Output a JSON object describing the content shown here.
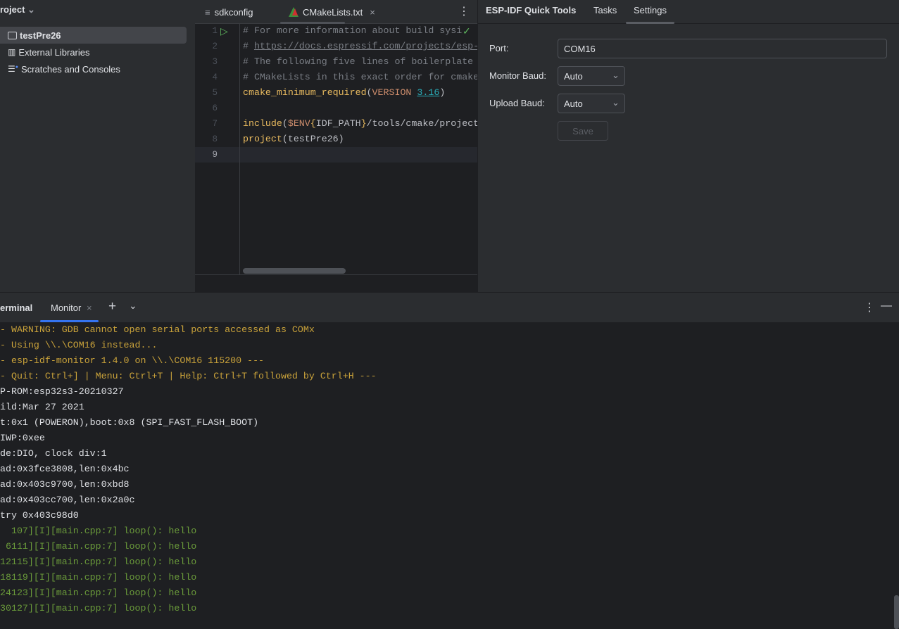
{
  "project": {
    "title": "roject",
    "items": [
      {
        "label": "testPre26",
        "icon": "folder-icon",
        "selected": true
      },
      {
        "label": "External Libraries",
        "icon": "library-icon"
      },
      {
        "label": "Scratches and Consoles",
        "icon": "scratches-icon"
      }
    ]
  },
  "editor": {
    "tabs": [
      {
        "label": "sdkconfig",
        "icon": "text-file-icon"
      },
      {
        "label": "CMakeLists.txt",
        "icon": "cmake-icon",
        "active": true
      }
    ],
    "line_numbers": [
      "1",
      "2",
      "3",
      "4",
      "5",
      "6",
      "7",
      "8",
      "9"
    ],
    "lines": [
      {
        "parts": [
          {
            "c": "cm",
            "t": "# For more information about build sysi"
          }
        ]
      },
      {
        "parts": [
          {
            "c": "cm",
            "t": "# "
          },
          {
            "c": "cm u",
            "t": "https://docs.espressif.com/projects/esp-"
          }
        ]
      },
      {
        "parts": [
          {
            "c": "cm",
            "t": "# The following five lines of boilerplate"
          }
        ]
      },
      {
        "parts": [
          {
            "c": "cm",
            "t": "# CMakeLists in this exact order for cmake"
          }
        ]
      },
      {
        "parts": [
          {
            "c": "fn",
            "t": "cmake_minimum_required"
          },
          {
            "c": "",
            "t": "("
          },
          {
            "c": "kw",
            "t": "VERSION "
          },
          {
            "c": "num",
            "t": "3.16"
          },
          {
            "c": "",
            "t": ")"
          }
        ]
      },
      {
        "parts": []
      },
      {
        "parts": [
          {
            "c": "fn",
            "t": "include"
          },
          {
            "c": "",
            "t": "("
          },
          {
            "c": "kw",
            "t": "$ENV"
          },
          {
            "c": "fn",
            "t": "{"
          },
          {
            "c": "",
            "t": "IDF_PATH"
          },
          {
            "c": "fn",
            "t": "}"
          },
          {
            "c": "",
            "t": "/tools/cmake/project"
          }
        ]
      },
      {
        "parts": [
          {
            "c": "fn",
            "t": "project"
          },
          {
            "c": "",
            "t": "(testPre26)"
          }
        ]
      },
      {
        "parts": []
      }
    ]
  },
  "tools": {
    "title": "ESP-IDF Quick Tools",
    "tabs": [
      "Tasks",
      "Settings"
    ],
    "active_tab": "Settings",
    "port_label": "Port:",
    "port_value": "COM16",
    "monitor_baud_label": "Monitor Baud:",
    "monitor_baud_value": "Auto",
    "upload_baud_label": "Upload Baud:",
    "upload_baud_value": "Auto",
    "save_label": "Save"
  },
  "terminal": {
    "title": "erminal",
    "tab": "Monitor",
    "lines": [
      {
        "c": "y",
        "t": "- WARNING: GDB cannot open serial ports accessed as COMx"
      },
      {
        "c": "y",
        "t": "- Using \\\\.\\COM16 instead..."
      },
      {
        "c": "y",
        "t": "- esp-idf-monitor 1.4.0 on \\\\.\\COM16 115200 ---"
      },
      {
        "c": "y",
        "t": "- Quit: Ctrl+] | Menu: Ctrl+T | Help: Ctrl+T followed by Ctrl+H ---"
      },
      {
        "c": "w",
        "t": "P-ROM:esp32s3-20210327"
      },
      {
        "c": "w",
        "t": "ild:Mar 27 2021"
      },
      {
        "c": "w",
        "t": "t:0x1 (POWERON),boot:0x8 (SPI_FAST_FLASH_BOOT)"
      },
      {
        "c": "w",
        "t": "IWP:0xee"
      },
      {
        "c": "w",
        "t": "de:DIO, clock div:1"
      },
      {
        "c": "w",
        "t": "ad:0x3fce3808,len:0x4bc"
      },
      {
        "c": "w",
        "t": "ad:0x403c9700,len:0xbd8"
      },
      {
        "c": "w",
        "t": "ad:0x403cc700,len:0x2a0c"
      },
      {
        "c": "w",
        "t": "try 0x403c98d0"
      },
      {
        "c": "g",
        "t": "  107][I][main.cpp:7] loop(): hello"
      },
      {
        "c": "g",
        "t": " 6111][I][main.cpp:7] loop(): hello"
      },
      {
        "c": "g",
        "t": "12115][I][main.cpp:7] loop(): hello"
      },
      {
        "c": "g",
        "t": "18119][I][main.cpp:7] loop(): hello"
      },
      {
        "c": "g",
        "t": "24123][I][main.cpp:7] loop(): hello"
      },
      {
        "c": "g",
        "t": "30127][I][main.cpp:7] loop(): hello"
      }
    ]
  },
  "colors": {
    "accent": "#3574f0",
    "warning_text": "#c9a23a",
    "log_info": "#6a9a3a"
  }
}
